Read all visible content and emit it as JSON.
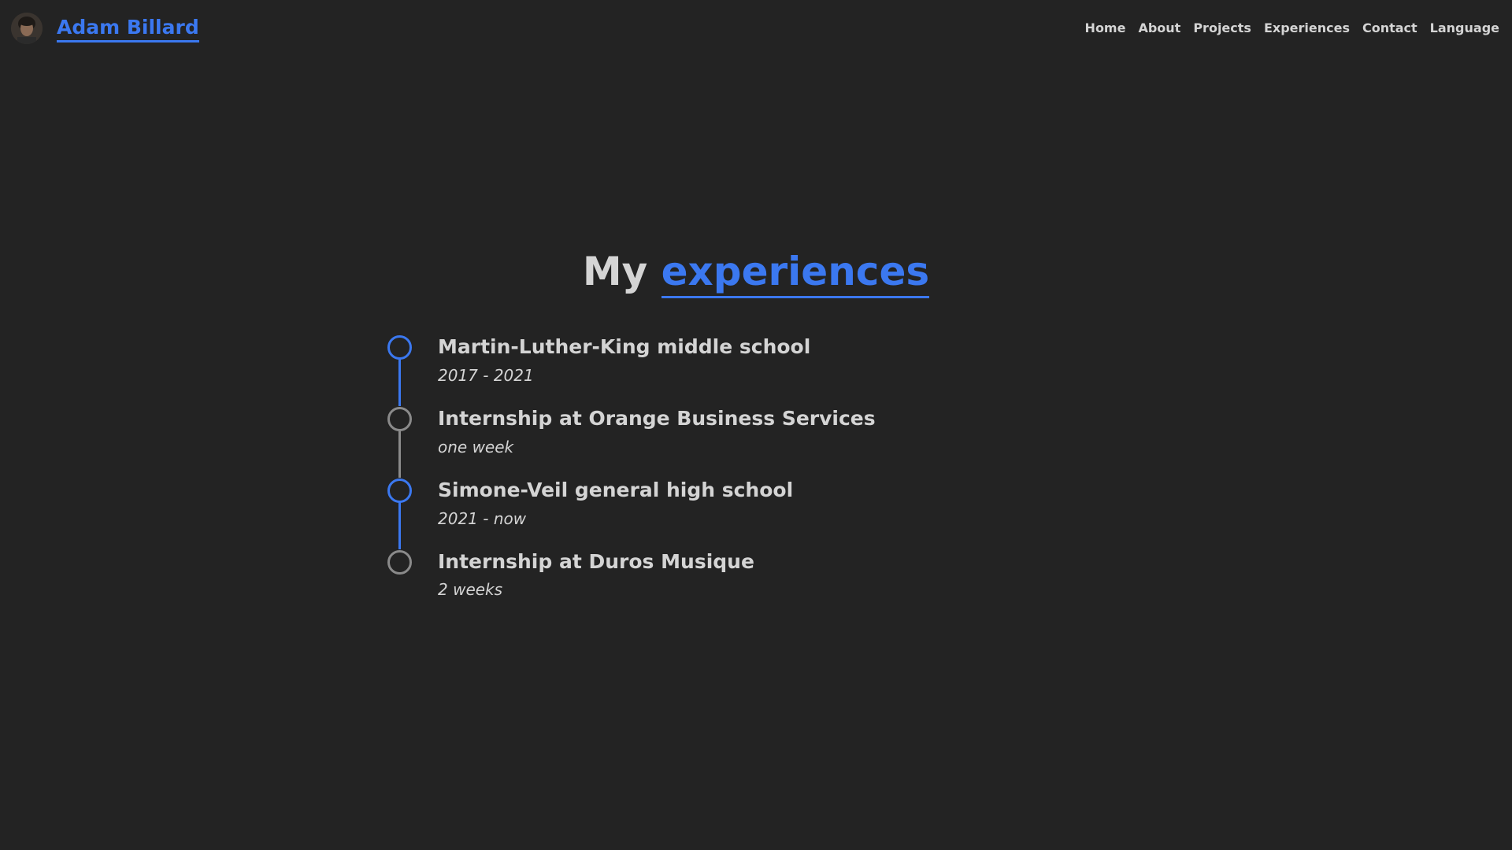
{
  "header": {
    "brand_name": "Adam Billard",
    "nav": [
      "Home",
      "About",
      "Projects",
      "Experiences",
      "Contact",
      "Language"
    ]
  },
  "title": {
    "prefix": "My",
    "highlight": "experiences"
  },
  "experiences": [
    {
      "title": "Martin-Luther-King middle school",
      "period": "2017 - 2021",
      "dot": "blue"
    },
    {
      "title": "Internship at Orange Business Services",
      "period": "one week",
      "dot": "grey"
    },
    {
      "title": "Simone-Veil general high school",
      "period": "2021 - now",
      "dot": "blue"
    },
    {
      "title": "Internship at Duros Musique",
      "period": "2 weeks",
      "dot": "grey"
    }
  ],
  "colors": {
    "background": "#232323",
    "accent": "#3b78f0",
    "text": "#d4d4d4",
    "muted_dot": "#8a8a8a"
  },
  "icons": {
    "avatar": "profile-photo"
  }
}
